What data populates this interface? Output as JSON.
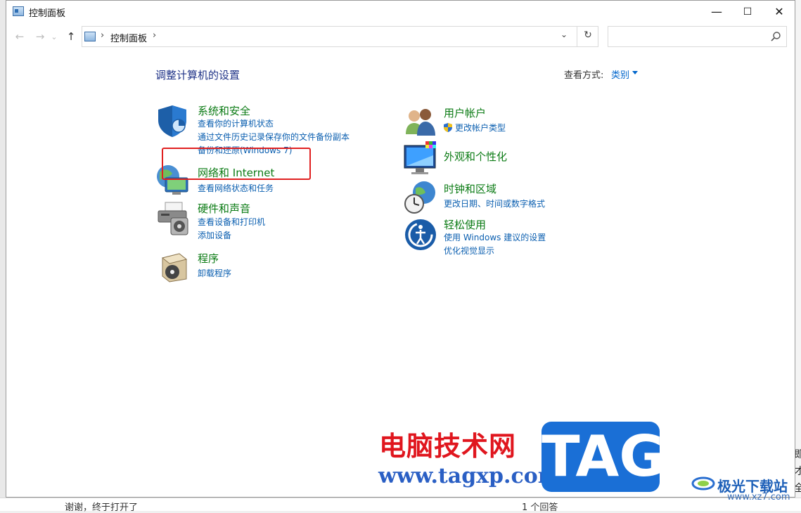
{
  "window": {
    "title": "控制面板"
  },
  "controls": {
    "minimize": "—",
    "maximize": "☐",
    "close": "✕"
  },
  "nav": {
    "back": "←",
    "forward": "→",
    "recent": "⌄",
    "up": "↑",
    "sep1": "›",
    "sep2": "›",
    "dropdown": "⌄",
    "refresh": "↻"
  },
  "address": {
    "path": "控制面板"
  },
  "search": {
    "placeholder": ""
  },
  "main": {
    "heading": "调整计算机的设置",
    "view_by_label": "查看方式:",
    "view_by_value": "类别"
  },
  "categories": [
    {
      "title": "系统和安全",
      "icon": "shield-icon",
      "links": [
        "查看你的计算机状态",
        "通过文件历史记录保存你的文件备份副本",
        "备份和还原(Windows 7)"
      ]
    },
    {
      "title": "网络和 Internet",
      "icon": "network-globe-icon",
      "links": [
        "查看网络状态和任务"
      ]
    },
    {
      "title": "硬件和声音",
      "icon": "printer-speaker-icon",
      "links": [
        "查看设备和打印机",
        "添加设备"
      ]
    },
    {
      "title": "程序",
      "icon": "programs-disc-icon",
      "links": [
        "卸载程序"
      ]
    },
    {
      "title": "用户帐户",
      "icon": "users-icon",
      "links": [
        "更改帐户类型"
      ]
    },
    {
      "title": "外观和个性化",
      "icon": "monitor-palette-icon",
      "links": []
    },
    {
      "title": "时钟和区域",
      "icon": "clock-globe-icon",
      "links": [
        "更改日期、时间或数字格式"
      ]
    },
    {
      "title": "轻松使用",
      "icon": "ease-of-access-icon",
      "links": [
        "使用 Windows 建议的设置",
        "优化视觉显示"
      ]
    }
  ],
  "watermark": {
    "cn": "电脑技术网",
    "url": "www.tagxp.com",
    "tag": "TAG",
    "site_name": "极光下载站",
    "site_url": "www.xz7.com"
  },
  "background": {
    "right_char_1": "即",
    "right_char_2": "才",
    "right_char_3": "全",
    "bottom_left": "谢谢，终于打开了",
    "bottom_right": "1 个回答"
  },
  "colors": {
    "category_title": "#0b7b14",
    "link": "#0b5fb0",
    "heading": "#1e3287",
    "highlight": "#e02020"
  }
}
